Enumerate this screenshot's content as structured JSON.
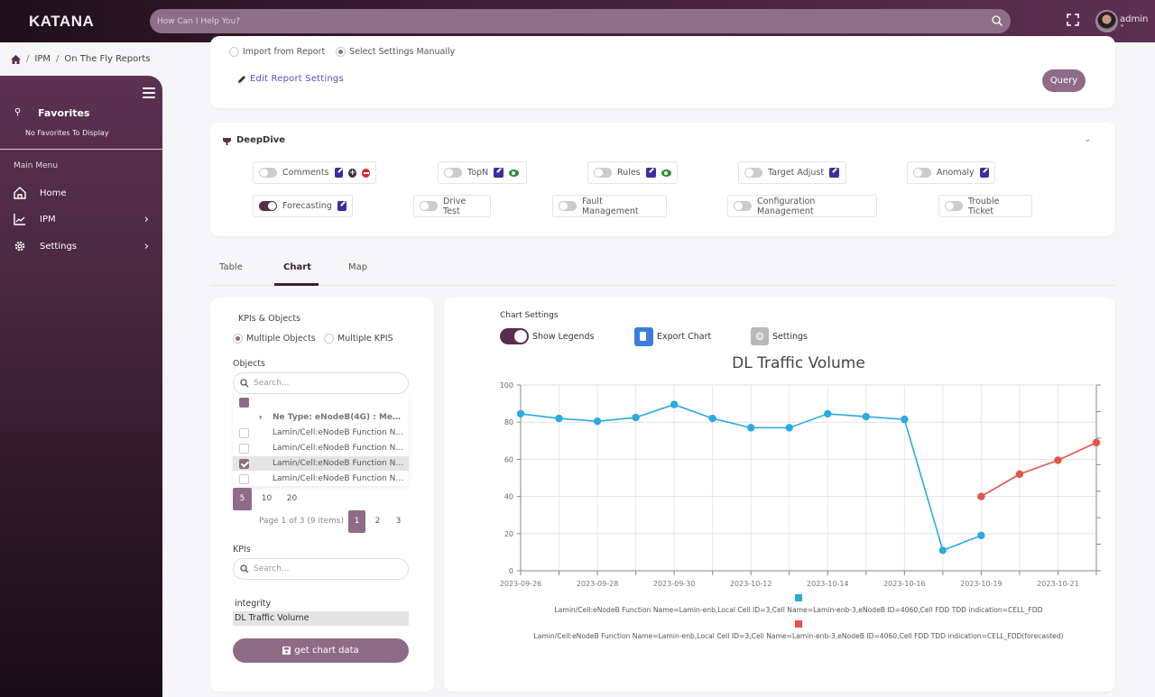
{
  "header": {
    "logo": "KATANA",
    "search_placeholder": "How Can I Help You?",
    "user": "admin"
  },
  "breadcrumb": [
    "IPM",
    "On The Fly Reports"
  ],
  "sidebar": {
    "favorites_title": "Favorites",
    "favorites_empty": "No Favorites To Display",
    "menu_label": "Main Menu",
    "items": [
      {
        "label": "Home",
        "icon": "home-icon"
      },
      {
        "label": "IPM",
        "icon": "chart-line-icon"
      },
      {
        "label": "Settings",
        "icon": "gear-icon"
      }
    ]
  },
  "report_settings": {
    "options": [
      {
        "label": "Import from Report",
        "selected": false
      },
      {
        "label": "Select Settings Manually",
        "selected": true
      }
    ],
    "edit_link": "Edit Report Settings",
    "query_button": "Query"
  },
  "deepdive": {
    "title": "DeepDive",
    "chips": [
      {
        "label": "Comments",
        "on": false
      },
      {
        "label": "TopN",
        "on": false
      },
      {
        "label": "Rules",
        "on": false
      },
      {
        "label": "Target Adjust",
        "on": false
      },
      {
        "label": "Anomaly",
        "on": false
      },
      {
        "label": "Forecasting",
        "on": true
      },
      {
        "label": "Drive Test",
        "on": false
      },
      {
        "label": "Fault Management",
        "on": false
      },
      {
        "label": "Configuration Management",
        "on": false
      },
      {
        "label": "Trouble Ticket",
        "on": false
      }
    ]
  },
  "tabs": [
    {
      "label": "Table",
      "active": false
    },
    {
      "label": "Chart",
      "active": true
    },
    {
      "label": "Map",
      "active": false
    }
  ],
  "left_panel": {
    "kpis_objects_label": "KPIs & Objects",
    "mode_options": [
      {
        "label": "Multiple Objects",
        "selected": true
      },
      {
        "label": "Multiple KPIS",
        "selected": false
      }
    ],
    "objects_label": "Objects",
    "objects_search_placeholder": "Search...",
    "group_header": "Ne Type: eNodeB(4G) : Measurement...",
    "objects": [
      {
        "label": "Lamin/Cell:eNodeB Function Name=Lamin-enb...",
        "checked": false
      },
      {
        "label": "Lamin/Cell:eNodeB Function Name=Lamin-enb...",
        "checked": false
      },
      {
        "label": "Lamin/Cell:eNodeB Function Name=Lamin-enb...",
        "checked": true
      },
      {
        "label": "Lamin/Cell:eNodeB Function Name=Lamin-enb...",
        "checked": false
      }
    ],
    "page_sizes": [
      "5",
      "10",
      "20"
    ],
    "active_page_size": "5",
    "page_info": "Page 1 of 3 (9 items)",
    "pages": [
      "1",
      "2",
      "3"
    ],
    "active_page": "1",
    "kpis_label": "KPIs",
    "kpis_search_placeholder": "Search...",
    "kpis": [
      {
        "label": "integrity",
        "selected": false
      },
      {
        "label": "DL Traffic Volume",
        "selected": true
      }
    ],
    "get_button": "get chart data"
  },
  "chart_settings": {
    "label": "Chart Settings",
    "show_legends": "Show Legends",
    "show_legends_on": true,
    "export": "Export Chart",
    "settings": "Settings"
  },
  "chart_data": {
    "type": "line",
    "title": "DL Traffic Volume",
    "xlabel": "",
    "ylabel": "",
    "ylim": [
      0,
      100
    ],
    "yticks": [
      0,
      20,
      40,
      60,
      80,
      100
    ],
    "x": [
      "2023-09-26",
      "2023-09-27",
      "2023-09-28",
      "2023-09-29",
      "2023-09-30",
      "2023-10-11",
      "2023-10-12",
      "2023-10-13",
      "2023-10-14",
      "2023-10-15",
      "2023-10-16",
      "2023-10-17",
      "2023-10-19",
      "2023-10-20",
      "2023-10-21",
      "2023-10-22"
    ],
    "xtick_labels": [
      "2023-09-26",
      "",
      "2023-09-28",
      "",
      "2023-09-30",
      "",
      "2023-10-12",
      "",
      "2023-10-14",
      "",
      "2023-10-16",
      "",
      "2023-10-19",
      "",
      "2023-10-21",
      ""
    ],
    "grid": true,
    "legend_position": "bottom",
    "series": [
      {
        "name": "Lamin/Cell:eNodeB Function Name=Lamin-enb,Local Cell ID=3,Cell Name=Lamin-enb-3,eNodeB ID=4060,Cell FDD TDD indication=CELL_FDD",
        "color": "#29abe2",
        "values": [
          84.5,
          82,
          80.5,
          82.5,
          89.5,
          82,
          77,
          77,
          84.5,
          83,
          81.5,
          11,
          19,
          null,
          null,
          null
        ]
      },
      {
        "name": "Lamin/Cell:eNodeB Function Name=Lamin-enb,Local Cell ID=3,Cell Name=Lamin-enb-3,eNodeB ID=4060,Cell FDD TDD indication=CELL_FDD(forecasted)",
        "color": "#e8524a",
        "values": [
          null,
          null,
          null,
          null,
          null,
          null,
          null,
          null,
          null,
          null,
          null,
          null,
          40,
          52,
          59.5,
          69
        ]
      }
    ]
  }
}
